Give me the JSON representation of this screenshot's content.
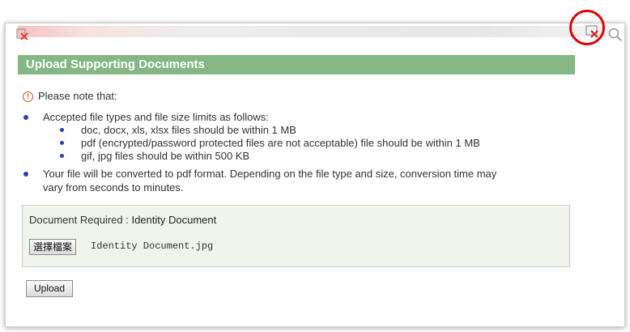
{
  "dialog": {
    "title": "Upload Supporting Documents",
    "note_label": "Please note that:",
    "bullets": [
      {
        "text": "Accepted file types and file size limits as follows:",
        "sub": [
          "doc, docx, xls, xlsx files should be within 1 MB",
          "pdf (encrypted/password protected files are not acceptable) file should be within 1 MB",
          "gif, jpg files should be within 500 KB"
        ]
      },
      {
        "lines": [
          "Your file will be converted to pdf format. Depending on the file type and size, conversion time may",
          "vary from seconds to minutes."
        ]
      }
    ],
    "document": {
      "required_label": "Document Required : ",
      "required_value": "Identity Document",
      "choose_button": "選擇檔案",
      "file_name": "Identity Document.jpg"
    },
    "upload_button": "Upload"
  },
  "icons": {
    "close": "close-window-icon",
    "search": "search-icon",
    "info": "info-icon"
  },
  "colors": {
    "header_bg": "#84b784",
    "highlight_ring": "#e10000",
    "bullet": "#2b3db3",
    "info": "#d0521d"
  }
}
